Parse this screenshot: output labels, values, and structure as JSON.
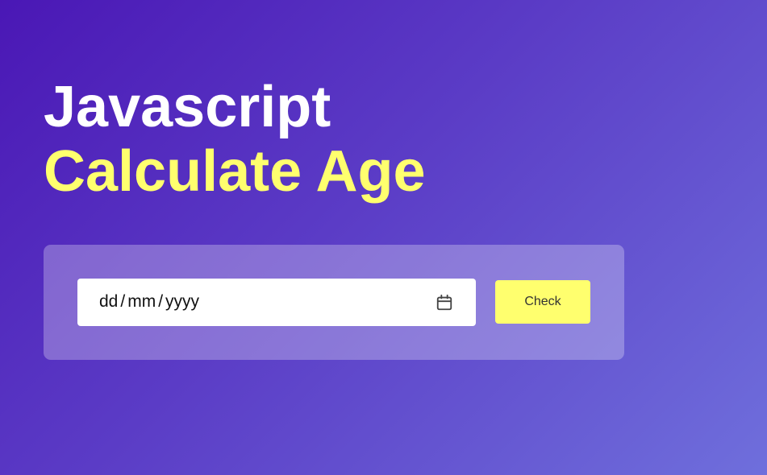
{
  "heading": {
    "line1": "Javascript",
    "line2": "Calculate Age"
  },
  "form": {
    "date_input": {
      "day_placeholder": "dd",
      "month_placeholder": "mm",
      "year_placeholder": "yyyy",
      "separator": "/",
      "icon": "calendar-icon"
    },
    "check_label": "Check"
  },
  "colors": {
    "accent_yellow": "#ffff6e",
    "heading_white": "#ffffff",
    "gradient_start": "#4a17b5",
    "gradient_end": "#6f6fdc"
  }
}
